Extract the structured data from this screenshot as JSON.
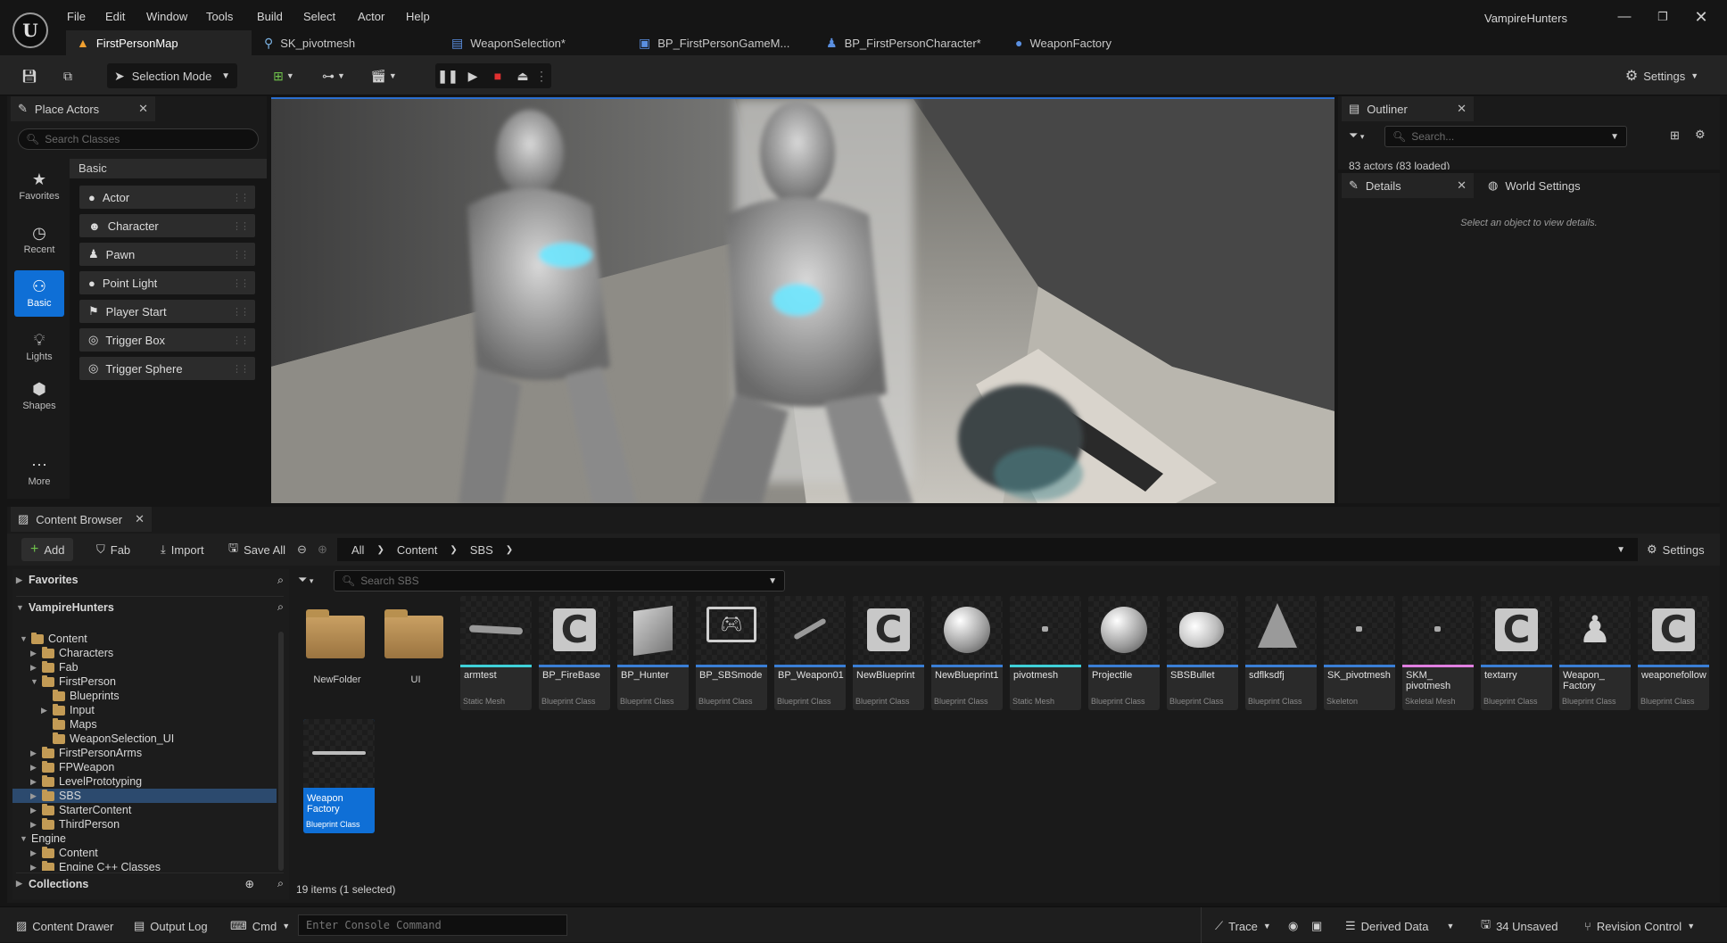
{
  "app": {
    "project_name": "VampireHunters",
    "logo_glyph": "U"
  },
  "menu": [
    "File",
    "Edit",
    "Window",
    "Tools",
    "Build",
    "Select",
    "Actor",
    "Help"
  ],
  "doc_tabs": [
    {
      "label": "FirstPersonMap",
      "icon": "level-icon"
    },
    {
      "label": "SK_pivotmesh",
      "icon": "skeleton-icon"
    },
    {
      "label": "WeaponSelection*",
      "icon": "widget-icon"
    },
    {
      "label": "BP_FirstPersonGameM...",
      "icon": "blueprint-icon"
    },
    {
      "label": "BP_FirstPersonCharacter*",
      "icon": "pawn-icon"
    },
    {
      "label": "WeaponFactory",
      "icon": "blueprint-icon"
    }
  ],
  "toolbar": {
    "mode_label": "Selection Mode",
    "settings_label": "Settings"
  },
  "place_actors": {
    "title": "Place Actors",
    "search_placeholder": "Search Classes",
    "category_header": "Basic",
    "nav": [
      {
        "label": "Favorites",
        "icon": "star-icon"
      },
      {
        "label": "Recent",
        "icon": "clock-icon"
      },
      {
        "label": "Basic",
        "icon": "shapes-icon"
      },
      {
        "label": "Lights",
        "icon": "bulb-icon"
      },
      {
        "label": "Shapes",
        "icon": "cube-icon"
      },
      {
        "label": "More",
        "icon": "ellipsis-icon"
      }
    ],
    "items": [
      {
        "label": "Actor",
        "icon": "sphere-icon"
      },
      {
        "label": "Character",
        "icon": "character-icon"
      },
      {
        "label": "Pawn",
        "icon": "pawn-icon"
      },
      {
        "label": "Point Light",
        "icon": "bulb-icon"
      },
      {
        "label": "Player Start",
        "icon": "flag-icon"
      },
      {
        "label": "Trigger Box",
        "icon": "sphere-icon"
      },
      {
        "label": "Trigger Sphere",
        "icon": "sphere-icon"
      }
    ]
  },
  "outliner": {
    "title": "Outliner",
    "search_placeholder": "Search...",
    "count_text": "83 actors (83 loaded)"
  },
  "details": {
    "title": "Details",
    "world_settings_label": "World Settings",
    "empty_text": "Select an object to view details."
  },
  "content_browser": {
    "title": "Content Browser",
    "add_label": "Add",
    "fab_label": "Fab",
    "import_label": "Import",
    "save_all_label": "Save All",
    "settings_label": "Settings",
    "breadcrumb": [
      "All",
      "Content",
      "SBS"
    ],
    "search_placeholder": "Search SBS",
    "favorites_label": "Favorites",
    "project_label": "VampireHunters",
    "collections_label": "Collections",
    "status_text": "19 items (1 selected)",
    "tree": [
      {
        "label": "Content",
        "depth": 1,
        "expanded": true
      },
      {
        "label": "Characters",
        "depth": 2
      },
      {
        "label": "Fab",
        "depth": 2
      },
      {
        "label": "FirstPerson",
        "depth": 2,
        "expanded": true
      },
      {
        "label": "Blueprints",
        "depth": 3,
        "leaf": true
      },
      {
        "label": "Input",
        "depth": 3
      },
      {
        "label": "Maps",
        "depth": 3,
        "leaf": true
      },
      {
        "label": "WeaponSelection_UI",
        "depth": 3,
        "leaf": true
      },
      {
        "label": "FirstPersonArms",
        "depth": 2
      },
      {
        "label": "FPWeapon",
        "depth": 2
      },
      {
        "label": "LevelPrototyping",
        "depth": 2
      },
      {
        "label": "SBS",
        "depth": 2,
        "selected": true
      },
      {
        "label": "StarterContent",
        "depth": 2
      },
      {
        "label": "ThirdPerson",
        "depth": 2
      },
      {
        "label": "Engine",
        "depth": 1,
        "expanded": true,
        "nofolder": true
      },
      {
        "label": "Content",
        "depth": 2
      },
      {
        "label": "Engine C++ Classes",
        "depth": 2
      }
    ],
    "assets": [
      {
        "name": "NewFolder",
        "type": "",
        "kind": "folder"
      },
      {
        "name": "UI",
        "type": "",
        "kind": "folder"
      },
      {
        "name": "armtest",
        "type": "Static Mesh",
        "kind": "mesh",
        "bar": "#3fd0d8"
      },
      {
        "name": "BP_FireBase",
        "type": "Blueprint Class",
        "kind": "bp",
        "bar": "#3a7fd6"
      },
      {
        "name": "BP_Hunter",
        "type": "Blueprint Class",
        "kind": "cube",
        "bar": "#3a7fd6"
      },
      {
        "name": "BP_SBSmode",
        "type": "Blueprint Class",
        "kind": "monitor",
        "bar": "#3a7fd6"
      },
      {
        "name": "BP_Weapon01",
        "type": "Blueprint Class",
        "kind": "stick",
        "bar": "#3a7fd6"
      },
      {
        "name": "NewBlueprint",
        "type": "Blueprint Class",
        "kind": "bp",
        "bar": "#3a7fd6"
      },
      {
        "name": "NewBlueprint1",
        "type": "Blueprint Class",
        "kind": "sphere",
        "bar": "#3a7fd6"
      },
      {
        "name": "pivotmesh",
        "type": "Static Mesh",
        "kind": "dot",
        "bar": "#3fd0d8"
      },
      {
        "name": "Projectile",
        "type": "Blueprint Class",
        "kind": "sphere",
        "bar": "#3a7fd6"
      },
      {
        "name": "SBSBullet",
        "type": "Blueprint Class",
        "kind": "bullet",
        "bar": "#3a7fd6"
      },
      {
        "name": "sdflksdfj",
        "type": "Blueprint Class",
        "kind": "triangle",
        "bar": "#3a7fd6"
      },
      {
        "name": "SK_pivotmesh",
        "type": "Skeleton",
        "kind": "dot",
        "bar": "#3a7fd6"
      },
      {
        "name": "SKM_ pivotmesh",
        "type": "Skeletal Mesh",
        "kind": "dot",
        "bar": "#e07fe0"
      },
      {
        "name": "textarry",
        "type": "Blueprint Class",
        "kind": "bp",
        "bar": "#3a7fd6"
      },
      {
        "name": "Weapon_ Factory",
        "type": "Blueprint Class",
        "kind": "pawn",
        "bar": "#3a7fd6"
      },
      {
        "name": "weaponefollow",
        "type": "Blueprint Class",
        "kind": "bp",
        "bar": "#3a7fd6"
      },
      {
        "name": "Weapon Factory",
        "type": "Blueprint Class",
        "kind": "gun",
        "bar": "#0f6fd6",
        "selected": true
      }
    ]
  },
  "statusbar": {
    "content_drawer": "Content Drawer",
    "output_log": "Output Log",
    "cmd": "Cmd",
    "console_placeholder": "Enter Console Command",
    "trace": "Trace",
    "derived_data": "Derived Data",
    "unsaved": "34 Unsaved",
    "revision": "Revision Control"
  }
}
